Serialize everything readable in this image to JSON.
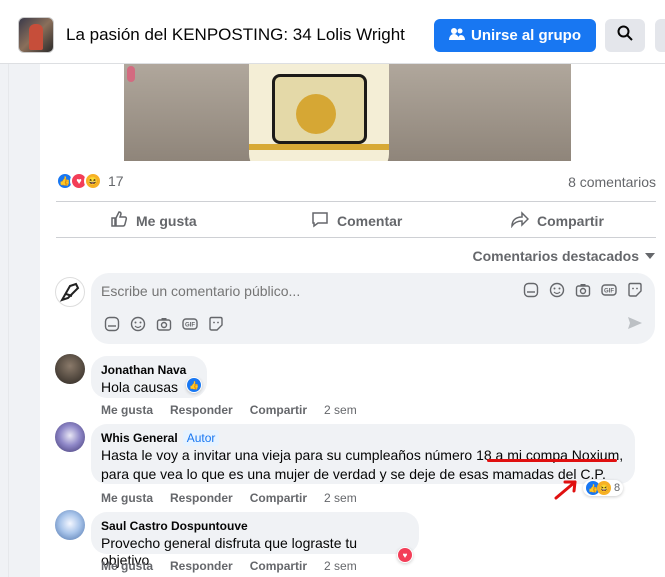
{
  "header": {
    "group_title": "La pasión del KENPOSTING: 34 Lolis Wright",
    "join_label": "Unirse al grupo"
  },
  "post": {
    "reaction_count": "17",
    "comment_count": "8 comentarios",
    "actions": {
      "like": "Me gusta",
      "comment": "Comentar",
      "share": "Compartir"
    },
    "featured_label": "Comentarios destacados"
  },
  "composer": {
    "placeholder": "Escribe un comentario público..."
  },
  "comments": [
    {
      "name": "Jonathan Nava",
      "text": "Hola causas",
      "actions": {
        "like": "Me gusta",
        "reply": "Responder",
        "share": "Compartir",
        "time": "2 sem"
      }
    },
    {
      "name": "Whis General",
      "badge": "Autor",
      "text_line1": "Hasta le voy a invitar una vieja para su cumpleaños número 18 a mi compa Noxium,",
      "text_line2": "para que vea lo que es una mujer de verdad y se deje de esas mamadas del C.P.",
      "reaction_count": "8",
      "actions": {
        "like": "Me gusta",
        "reply": "Responder",
        "share": "Compartir",
        "time": "2 sem"
      }
    },
    {
      "name": "Saul Castro Dospuntouve",
      "text": "Provecho general disfruta que lograste tu objetivo",
      "actions": {
        "like": "Me gusta",
        "reply": "Responder",
        "share": "Compartir",
        "time": "2 sem"
      }
    }
  ],
  "colors": {
    "primary": "#1877f2",
    "annotation_red": "#e01010"
  }
}
